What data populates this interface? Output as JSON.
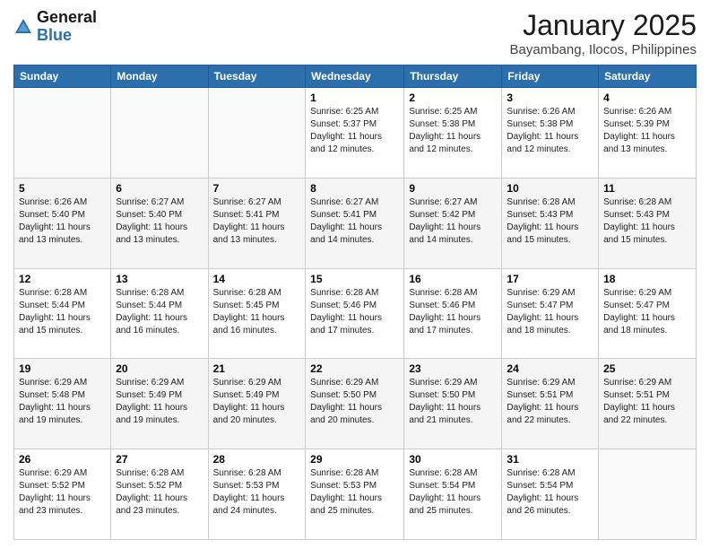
{
  "logo": {
    "general": "General",
    "blue": "Blue"
  },
  "header": {
    "title": "January 2025",
    "subtitle": "Bayambang, Ilocos, Philippines"
  },
  "weekdays": [
    "Sunday",
    "Monday",
    "Tuesday",
    "Wednesday",
    "Thursday",
    "Friday",
    "Saturday"
  ],
  "weeks": [
    [
      {
        "day": "",
        "sunrise": "",
        "sunset": "",
        "daylight": ""
      },
      {
        "day": "",
        "sunrise": "",
        "sunset": "",
        "daylight": ""
      },
      {
        "day": "",
        "sunrise": "",
        "sunset": "",
        "daylight": ""
      },
      {
        "day": "1",
        "sunrise": "Sunrise: 6:25 AM",
        "sunset": "Sunset: 5:37 PM",
        "daylight": "Daylight: 11 hours and 12 minutes."
      },
      {
        "day": "2",
        "sunrise": "Sunrise: 6:25 AM",
        "sunset": "Sunset: 5:38 PM",
        "daylight": "Daylight: 11 hours and 12 minutes."
      },
      {
        "day": "3",
        "sunrise": "Sunrise: 6:26 AM",
        "sunset": "Sunset: 5:38 PM",
        "daylight": "Daylight: 11 hours and 12 minutes."
      },
      {
        "day": "4",
        "sunrise": "Sunrise: 6:26 AM",
        "sunset": "Sunset: 5:39 PM",
        "daylight": "Daylight: 11 hours and 13 minutes."
      }
    ],
    [
      {
        "day": "5",
        "sunrise": "Sunrise: 6:26 AM",
        "sunset": "Sunset: 5:40 PM",
        "daylight": "Daylight: 11 hours and 13 minutes."
      },
      {
        "day": "6",
        "sunrise": "Sunrise: 6:27 AM",
        "sunset": "Sunset: 5:40 PM",
        "daylight": "Daylight: 11 hours and 13 minutes."
      },
      {
        "day": "7",
        "sunrise": "Sunrise: 6:27 AM",
        "sunset": "Sunset: 5:41 PM",
        "daylight": "Daylight: 11 hours and 13 minutes."
      },
      {
        "day": "8",
        "sunrise": "Sunrise: 6:27 AM",
        "sunset": "Sunset: 5:41 PM",
        "daylight": "Daylight: 11 hours and 14 minutes."
      },
      {
        "day": "9",
        "sunrise": "Sunrise: 6:27 AM",
        "sunset": "Sunset: 5:42 PM",
        "daylight": "Daylight: 11 hours and 14 minutes."
      },
      {
        "day": "10",
        "sunrise": "Sunrise: 6:28 AM",
        "sunset": "Sunset: 5:43 PM",
        "daylight": "Daylight: 11 hours and 15 minutes."
      },
      {
        "day": "11",
        "sunrise": "Sunrise: 6:28 AM",
        "sunset": "Sunset: 5:43 PM",
        "daylight": "Daylight: 11 hours and 15 minutes."
      }
    ],
    [
      {
        "day": "12",
        "sunrise": "Sunrise: 6:28 AM",
        "sunset": "Sunset: 5:44 PM",
        "daylight": "Daylight: 11 hours and 15 minutes."
      },
      {
        "day": "13",
        "sunrise": "Sunrise: 6:28 AM",
        "sunset": "Sunset: 5:44 PM",
        "daylight": "Daylight: 11 hours and 16 minutes."
      },
      {
        "day": "14",
        "sunrise": "Sunrise: 6:28 AM",
        "sunset": "Sunset: 5:45 PM",
        "daylight": "Daylight: 11 hours and 16 minutes."
      },
      {
        "day": "15",
        "sunrise": "Sunrise: 6:28 AM",
        "sunset": "Sunset: 5:46 PM",
        "daylight": "Daylight: 11 hours and 17 minutes."
      },
      {
        "day": "16",
        "sunrise": "Sunrise: 6:28 AM",
        "sunset": "Sunset: 5:46 PM",
        "daylight": "Daylight: 11 hours and 17 minutes."
      },
      {
        "day": "17",
        "sunrise": "Sunrise: 6:29 AM",
        "sunset": "Sunset: 5:47 PM",
        "daylight": "Daylight: 11 hours and 18 minutes."
      },
      {
        "day": "18",
        "sunrise": "Sunrise: 6:29 AM",
        "sunset": "Sunset: 5:47 PM",
        "daylight": "Daylight: 11 hours and 18 minutes."
      }
    ],
    [
      {
        "day": "19",
        "sunrise": "Sunrise: 6:29 AM",
        "sunset": "Sunset: 5:48 PM",
        "daylight": "Daylight: 11 hours and 19 minutes."
      },
      {
        "day": "20",
        "sunrise": "Sunrise: 6:29 AM",
        "sunset": "Sunset: 5:49 PM",
        "daylight": "Daylight: 11 hours and 19 minutes."
      },
      {
        "day": "21",
        "sunrise": "Sunrise: 6:29 AM",
        "sunset": "Sunset: 5:49 PM",
        "daylight": "Daylight: 11 hours and 20 minutes."
      },
      {
        "day": "22",
        "sunrise": "Sunrise: 6:29 AM",
        "sunset": "Sunset: 5:50 PM",
        "daylight": "Daylight: 11 hours and 20 minutes."
      },
      {
        "day": "23",
        "sunrise": "Sunrise: 6:29 AM",
        "sunset": "Sunset: 5:50 PM",
        "daylight": "Daylight: 11 hours and 21 minutes."
      },
      {
        "day": "24",
        "sunrise": "Sunrise: 6:29 AM",
        "sunset": "Sunset: 5:51 PM",
        "daylight": "Daylight: 11 hours and 22 minutes."
      },
      {
        "day": "25",
        "sunrise": "Sunrise: 6:29 AM",
        "sunset": "Sunset: 5:51 PM",
        "daylight": "Daylight: 11 hours and 22 minutes."
      }
    ],
    [
      {
        "day": "26",
        "sunrise": "Sunrise: 6:29 AM",
        "sunset": "Sunset: 5:52 PM",
        "daylight": "Daylight: 11 hours and 23 minutes."
      },
      {
        "day": "27",
        "sunrise": "Sunrise: 6:28 AM",
        "sunset": "Sunset: 5:52 PM",
        "daylight": "Daylight: 11 hours and 23 minutes."
      },
      {
        "day": "28",
        "sunrise": "Sunrise: 6:28 AM",
        "sunset": "Sunset: 5:53 PM",
        "daylight": "Daylight: 11 hours and 24 minutes."
      },
      {
        "day": "29",
        "sunrise": "Sunrise: 6:28 AM",
        "sunset": "Sunset: 5:53 PM",
        "daylight": "Daylight: 11 hours and 25 minutes."
      },
      {
        "day": "30",
        "sunrise": "Sunrise: 6:28 AM",
        "sunset": "Sunset: 5:54 PM",
        "daylight": "Daylight: 11 hours and 25 minutes."
      },
      {
        "day": "31",
        "sunrise": "Sunrise: 6:28 AM",
        "sunset": "Sunset: 5:54 PM",
        "daylight": "Daylight: 11 hours and 26 minutes."
      },
      {
        "day": "",
        "sunrise": "",
        "sunset": "",
        "daylight": ""
      }
    ]
  ]
}
